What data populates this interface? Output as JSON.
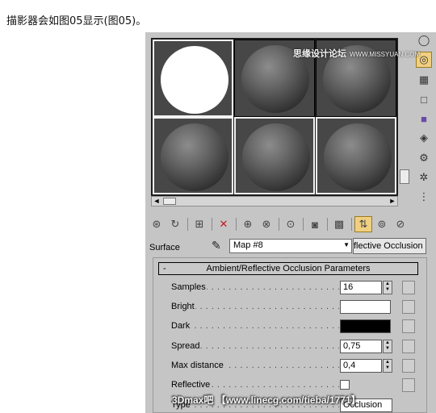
{
  "caption": "描影器会如图05显示(图05)。",
  "sample_slots": [
    {
      "sphere": "white",
      "active": true
    },
    {
      "sphere": "gray",
      "active": false
    },
    {
      "sphere": "gray",
      "active": false
    },
    {
      "sphere": "gray",
      "active": true
    },
    {
      "sphere": "gray",
      "active": true
    },
    {
      "sphere": "gray",
      "active": true
    }
  ],
  "scroll": {
    "left_arrow": "◄",
    "right_arrow": "►",
    "down_arrow": "▼"
  },
  "sidebar_icons": [
    "sphere-type-icon",
    "backlight-icon",
    "background-checker-icon",
    "sample-uv-tiling-icon",
    "video-color-check-icon",
    "make-preview-icon",
    "options-icon",
    "select-by-material-icon",
    "material-map-navigator-icon"
  ],
  "toolbar_icons": [
    "get-material-icon",
    "put-to-scene-icon",
    "assign-to-selection-icon",
    "reset-map-icon",
    "make-unique-icon",
    "put-to-library-icon",
    "material-id-channel-icon",
    "show-map-in-viewport-icon",
    "show-end-result-icon",
    "go-to-parent-icon",
    "go-forward-to-sibling-icon"
  ],
  "surface": {
    "label": "Surface",
    "map_name": "Map #8",
    "map_type": "flective Occlusion"
  },
  "rollout": {
    "title": "Ambient/Reflective Occlusion Parameters",
    "toggle": "-",
    "params": {
      "samples": {
        "label": "Samples",
        "value": "16"
      },
      "bright": {
        "label": "Bright",
        "color": "#ffffff"
      },
      "dark": {
        "label": "Dark",
        "color": "#000000"
      },
      "spread": {
        "label": "Spread",
        "value": "0,75"
      },
      "max_distance": {
        "label": "Max distance",
        "value": "0,4"
      },
      "reflective": {
        "label": "Reflective",
        "checked": false
      },
      "type": {
        "label": "Type",
        "value": "Occlusion"
      }
    }
  },
  "watermarks": {
    "top_main": "思缘设计论坛",
    "top_url": "WWW.MISSYUAN.COM",
    "bottom": "3Dmax吧 【www.linecg.com/tieba/1771】"
  },
  "colors": {
    "panel": "#c5c5c5",
    "slot_bg": "#474747",
    "active_button": "#f0d080"
  }
}
